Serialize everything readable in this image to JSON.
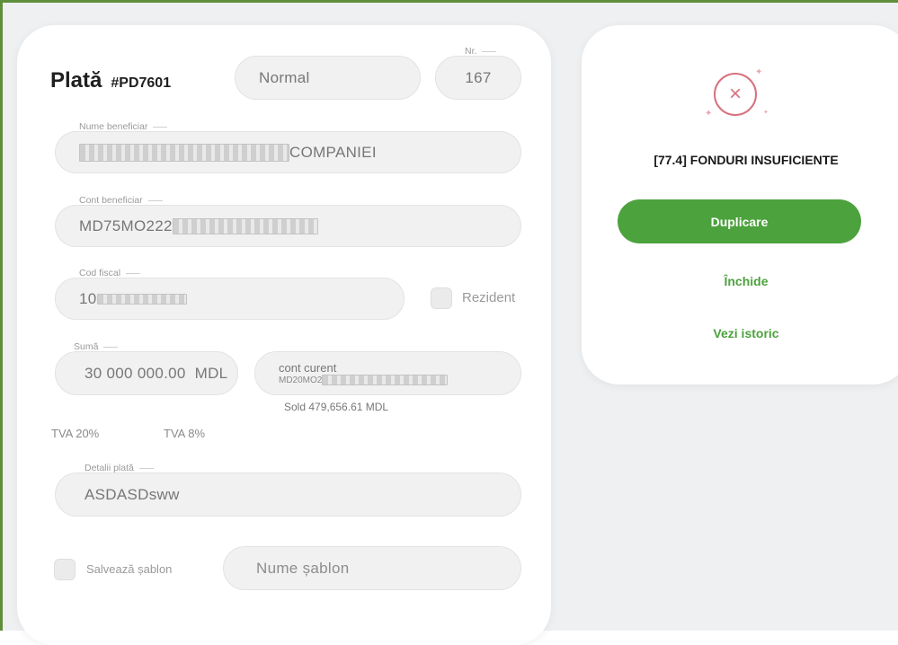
{
  "payment": {
    "title": "Plată",
    "code": "#PD7601",
    "type_value": "Normal",
    "nr_label": "Nr.",
    "nr_value": "167"
  },
  "fields": {
    "beneficiary_name": {
      "label": "Nume beneficiar",
      "visible_suffix": "COMPANIEI"
    },
    "beneficiary_account": {
      "label": "Cont beneficiar",
      "visible_prefix": "MD75MO222"
    },
    "fiscal_code": {
      "label": "Cod fiscal",
      "visible_prefix": "10"
    },
    "resident_label": "Rezident",
    "amount": {
      "label": "Sumă",
      "value": "30 000 000.00",
      "currency": "MDL"
    },
    "source_account": {
      "name": "cont curent",
      "visible_prefix": "MD20MO2"
    },
    "balance": "Sold 479,656.61 MDL",
    "tva_20": "TVA 20%",
    "tva_8": "TVA 8%",
    "details": {
      "label": "Detalii plată",
      "value": "ASDASDsww"
    },
    "save_template_label": "Salvează șablon",
    "template_name_placeholder": "Nume șablon"
  },
  "status": {
    "icon": "error-circle-x-icon",
    "message": "[77.4] FONDURI INSUFICIENTE",
    "duplicate_label": "Duplicare",
    "close_label": "Închide",
    "history_label": "Vezi istoric"
  },
  "colors": {
    "accent_green": "#4ca23d",
    "error_red": "#d6727e",
    "frame_green": "#5f8f3a"
  }
}
